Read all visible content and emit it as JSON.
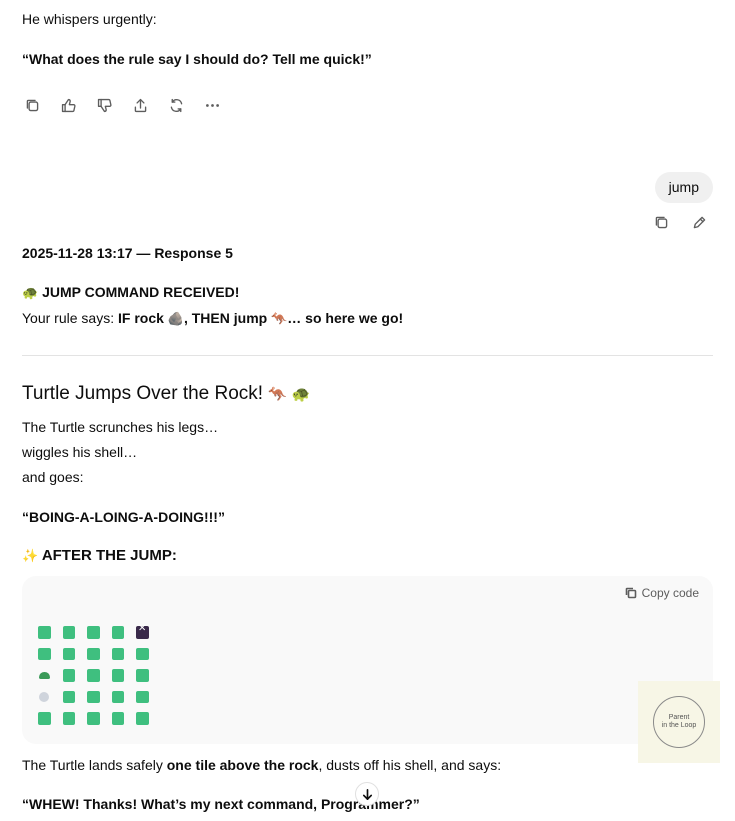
{
  "prev_message": {
    "line1": "He whispers urgently:",
    "quote": "“What does the rule say I should do? Tell me quick!”"
  },
  "message_actions": {
    "icons": [
      "copy-icon",
      "thumbs-up-icon",
      "thumbs-down-icon",
      "share-icon",
      "regenerate-icon",
      "more-icon"
    ]
  },
  "user_message": {
    "text": "jump",
    "icons": [
      "copy-icon",
      "edit-icon"
    ]
  },
  "response": {
    "header": "2025-11-28 13:17 — Response 5",
    "cmd_emoji": "🐢",
    "cmd_title": "JUMP COMMAND RECEIVED!",
    "rule_prefix": "Your rule says: ",
    "rule_if": "IF rock",
    "rule_rock_emoji": "🪨",
    "rule_then": ", THEN jump",
    "rule_jump_emoji": "🦘",
    "rule_end": "… so here we go!",
    "heading": "Turtle Jumps Over the Rock!",
    "heading_emojis": "🦘 🐢",
    "line_a": "The Turtle scrunches his legs…",
    "line_b": "wiggles his shell…",
    "line_c": "and goes:",
    "boing": "“BOING-A-LOING-A-DOING!!!”",
    "after_emoji": "✨",
    "after_title": "AFTER THE JUMP:",
    "copy_code_label": "Copy code",
    "grid": [
      [
        "green",
        "green",
        "green",
        "green",
        "pirate"
      ],
      [
        "green",
        "green",
        "green",
        "green",
        "green"
      ],
      [
        "turtle",
        "green",
        "green",
        "green",
        "green"
      ],
      [
        "rock",
        "green",
        "green",
        "green",
        "green"
      ],
      [
        "green",
        "green",
        "green",
        "green",
        "green"
      ]
    ],
    "land_prefix": "The Turtle lands safely ",
    "land_bold": "one tile above the rock",
    "land_suffix": ", dusts off his shell, and says:",
    "final_quote": "“WHEW! Thanks! What’s my next command, Programmer?”"
  },
  "watermark": {
    "line1": "Parent",
    "line2": "in the Loop"
  },
  "colors": {
    "tile_green": "#3fbf7f",
    "code_bg": "#f9f9f9",
    "bubble_bg": "#f0f0f0"
  }
}
